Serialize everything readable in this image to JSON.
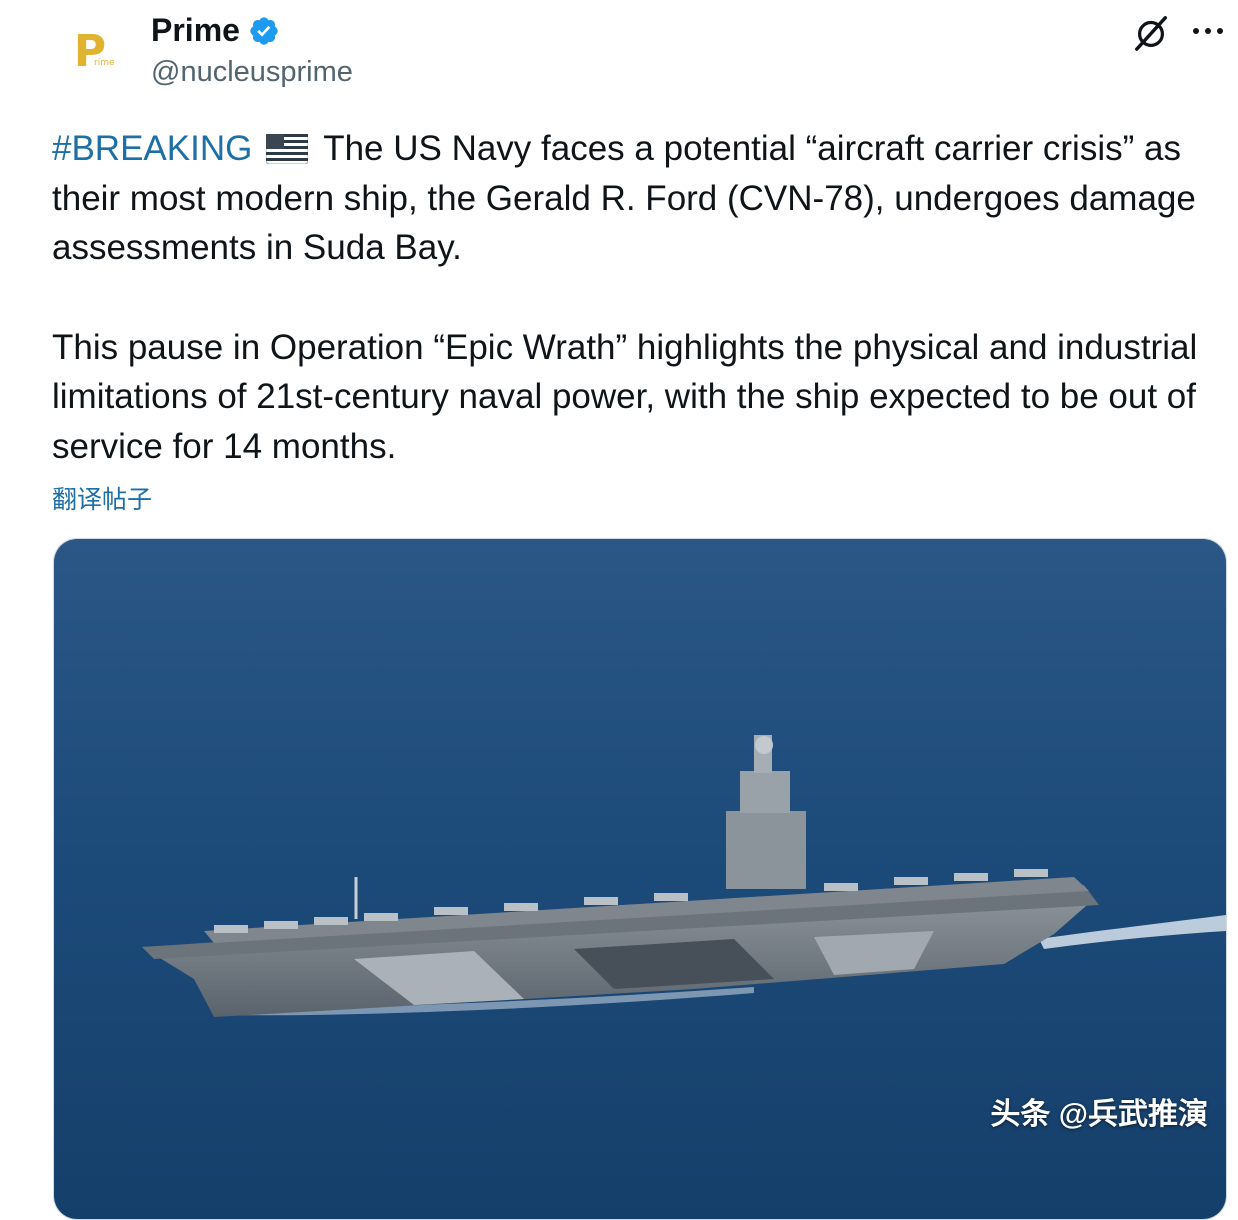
{
  "post": {
    "author": {
      "display_name": "Prime",
      "handle": "@nucleusprime",
      "verified": true,
      "avatar_letter": "P",
      "avatar_sub": "rime",
      "verified_color": "#1d9bf0"
    },
    "icons": {
      "grok": "grok-icon",
      "more": "more-icon",
      "verified": "verified-badge-icon",
      "flag": "us-flag-icon"
    },
    "hashtag": "#BREAKING",
    "paragraph1": "The US Navy faces a potential “aircraft carrier crisis” as their most modern ship, the Gerald R. Ford (CVN-78), undergoes damage assessments in Suda Bay.",
    "paragraph2": "This pause in Operation “Epic Wrath” highlights the physical and industrial limitations of 21st-century naval power, with the ship expected to be out of service for 14 months.",
    "translate_label": "翻译帖子",
    "media": {
      "description_icon": "aircraft-carrier-photo",
      "watermark": "头条 @兵武推演"
    }
  },
  "colors": {
    "link": "#1d6fa5",
    "text": "#0f1419",
    "muted": "#536471",
    "sea": "#1c4a78"
  }
}
